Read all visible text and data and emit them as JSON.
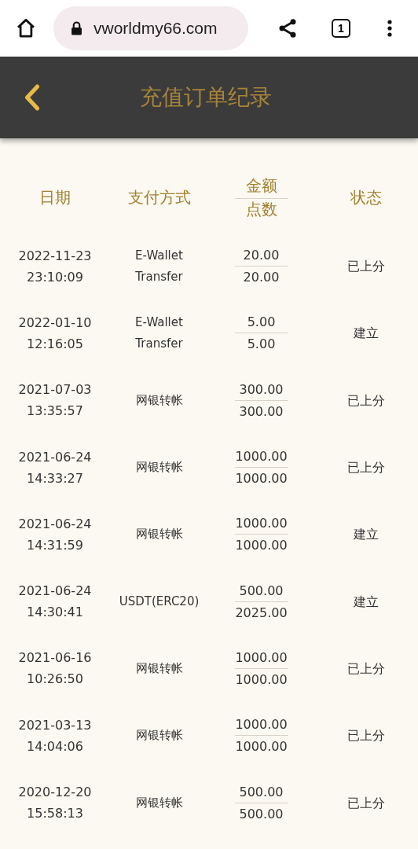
{
  "browser": {
    "url": "vworldmy66.com",
    "tab_count": "1"
  },
  "header": {
    "title": "充值订单纪录"
  },
  "table": {
    "columns": {
      "date": "日期",
      "method": "支付方式",
      "amount": "金额",
      "points": "点数",
      "status": "状态"
    },
    "rows": [
      {
        "date": "2022-11-23",
        "time": "23:10:09",
        "method": "E-Wallet Transfer",
        "amount": "20.00",
        "points": "20.00",
        "status": "已上分"
      },
      {
        "date": "2022-01-10",
        "time": "12:16:05",
        "method": "E-Wallet Transfer",
        "amount": "5.00",
        "points": "5.00",
        "status": "建立"
      },
      {
        "date": "2021-07-03",
        "time": "13:35:57",
        "method": "网银转帐",
        "amount": "300.00",
        "points": "300.00",
        "status": "已上分"
      },
      {
        "date": "2021-06-24",
        "time": "14:33:27",
        "method": "网银转帐",
        "amount": "1000.00",
        "points": "1000.00",
        "status": "已上分"
      },
      {
        "date": "2021-06-24",
        "time": "14:31:59",
        "method": "网银转帐",
        "amount": "1000.00",
        "points": "1000.00",
        "status": "建立"
      },
      {
        "date": "2021-06-24",
        "time": "14:30:41",
        "method": "USDT(ERC20)",
        "amount": "500.00",
        "points": "2025.00",
        "status": "建立"
      },
      {
        "date": "2021-06-16",
        "time": "10:26:50",
        "method": "网银转帐",
        "amount": "1000.00",
        "points": "1000.00",
        "status": "已上分"
      },
      {
        "date": "2021-03-13",
        "time": "14:04:06",
        "method": "网银转帐",
        "amount": "1000.00",
        "points": "1000.00",
        "status": "已上分"
      },
      {
        "date": "2020-12-20",
        "time": "15:58:13",
        "method": "网银转帐",
        "amount": "500.00",
        "points": "500.00",
        "status": "已上分"
      }
    ]
  }
}
